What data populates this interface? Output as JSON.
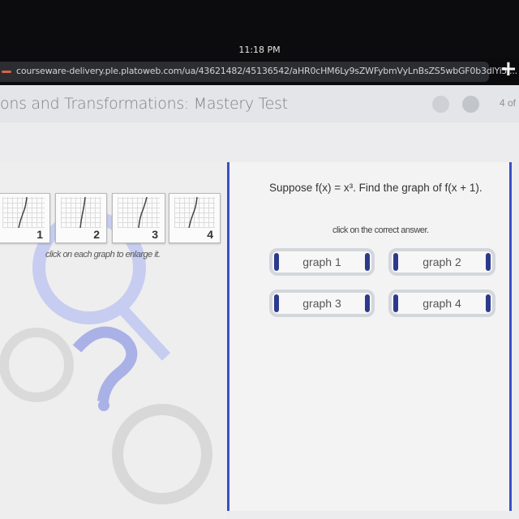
{
  "status": {
    "time": "11:18 PM"
  },
  "browser": {
    "url": "courseware-delivery.ple.platoweb.com/ua/43621482/45136542/aHR0cHM6Ly9sZWFybmVyLnBsZS5wbGF0b3dlYi5j...",
    "new_tab_icon": "plus-icon"
  },
  "header": {
    "title": "ons and Transformations: Mastery Test",
    "page_indicator": "4 of"
  },
  "left": {
    "thumbnails": [
      "1",
      "2",
      "3",
      "4"
    ],
    "caption": "click on each graph to enlarge it."
  },
  "question": {
    "text": "Suppose f(x) = x³. Find the graph of f(x + 1).",
    "instruction": "click on the correct answer."
  },
  "answers": [
    "graph 1",
    "graph 2",
    "graph 3",
    "graph 4"
  ],
  "colors": {
    "accent": "#3b4fc4",
    "button_bar": "#2d3a8c"
  }
}
